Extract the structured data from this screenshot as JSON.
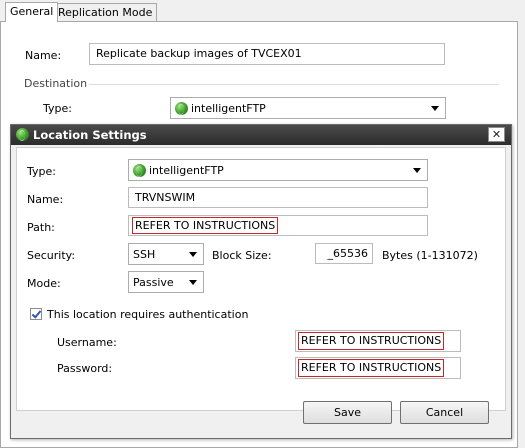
{
  "tabs": {
    "general": "General",
    "replication": "Replication Mode"
  },
  "main": {
    "name_label": "Name:",
    "name_value": "Replicate backup images of TVCEX01",
    "destination_label": "Destination",
    "type_label": "Type:",
    "type_value": "intelligentFTP",
    "type_icon": "globe-icon"
  },
  "dialog": {
    "title": "Location Settings",
    "close_glyph": "✕",
    "type_label": "Type:",
    "type_value": "intelligentFTP",
    "name_label": "Name:",
    "name_value": "TRVNSWIM",
    "path_label": "Path:",
    "path_value": "REFER TO INSTRUCTIONS",
    "security_label": "Security:",
    "security_value": "SSH",
    "blocksize_label": "Block Size:",
    "blocksize_value": "_65536",
    "blocksize_range": "Bytes (1-131072)",
    "mode_label": "Mode:",
    "mode_value": "Passive",
    "auth_label": "This location requires authentication",
    "auth_checked": true,
    "username_label": "Username:",
    "username_value": "REFER TO INSTRUCTIONS",
    "password_label": "Password:",
    "password_value": "REFER TO INSTRUCTIONS",
    "save_label": "Save",
    "cancel_label": "Cancel"
  },
  "colors": {
    "highlight": "#c62828",
    "titlebar": "#333333",
    "checkmark": "#2e5aa8"
  }
}
